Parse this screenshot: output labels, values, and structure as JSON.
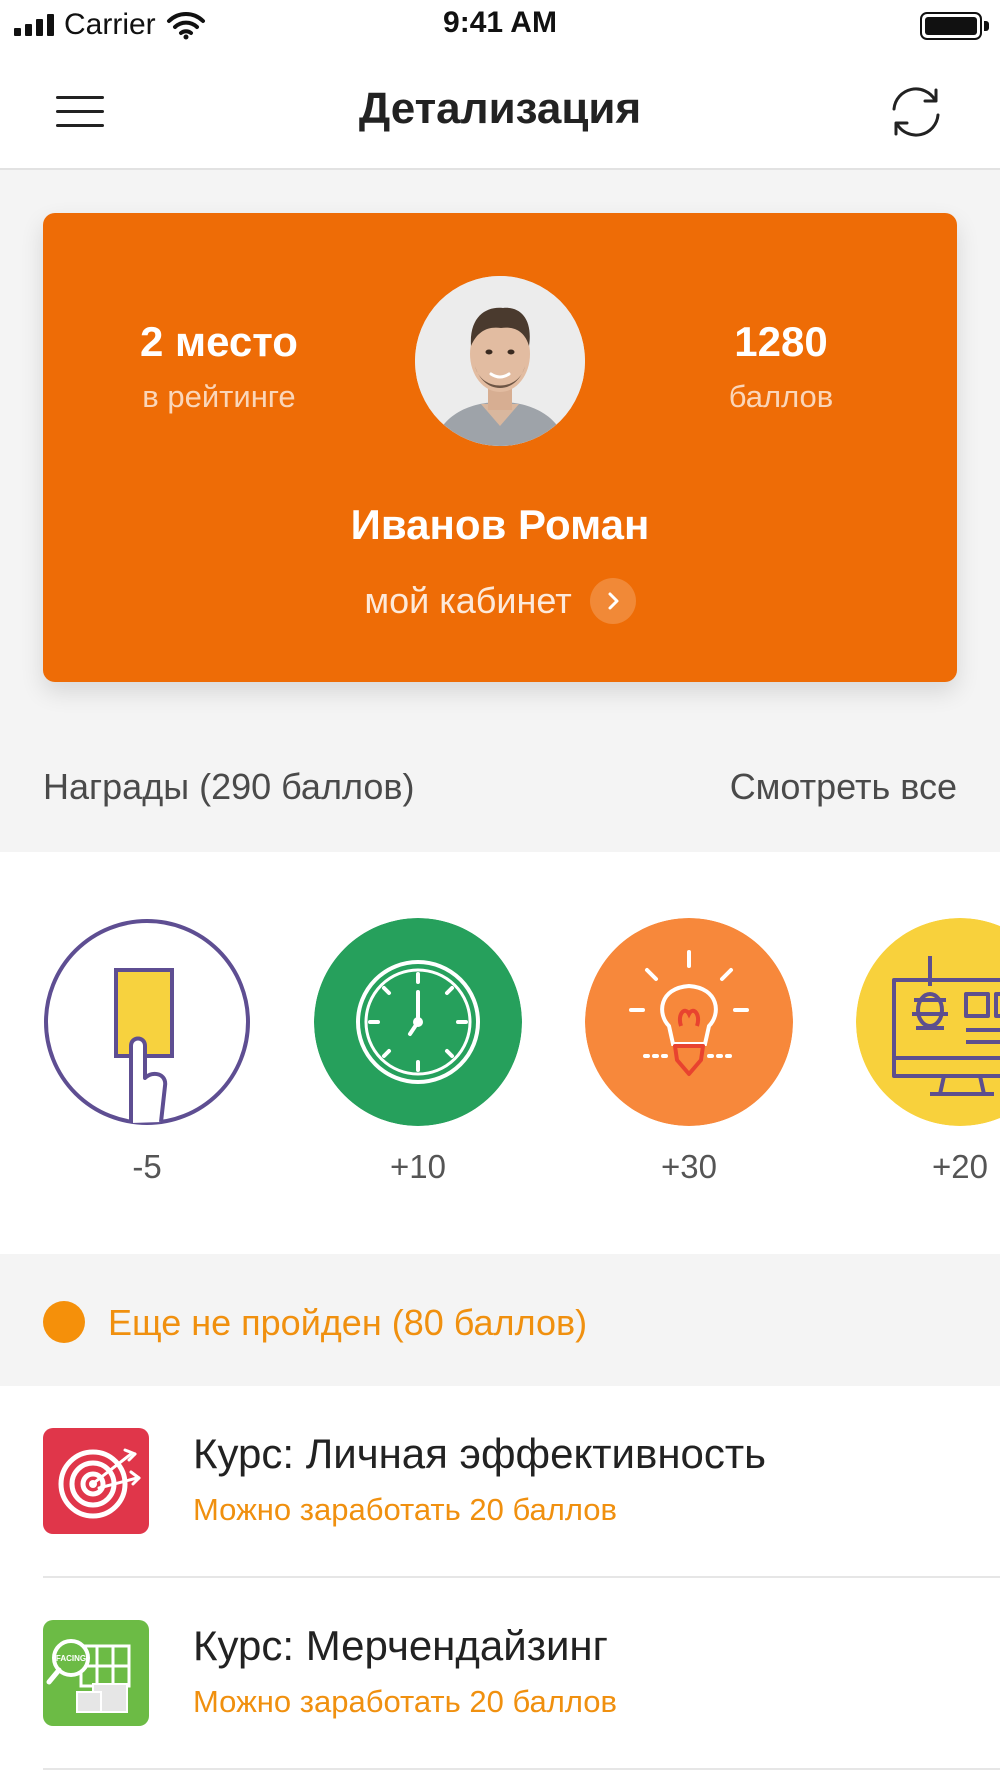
{
  "status_bar": {
    "carrier": "Carrier",
    "time": "9:41 AM"
  },
  "header": {
    "title": "Детализация",
    "menu_icon": "hamburger-icon",
    "refresh_icon": "refresh-icon"
  },
  "profile": {
    "rank_value": "2 место",
    "rank_caption": "в рейтинге",
    "points_value": "1280",
    "points_caption": "баллов",
    "name": "Иванов Роман",
    "cabinet_label": "мой кабинет",
    "card_color": "#ee6c06"
  },
  "rewards": {
    "title": "Награды (290 баллов)",
    "see_all": "Смотреть все",
    "badges": [
      {
        "icon": "yellow-card-icon",
        "points": "-5"
      },
      {
        "icon": "clock-icon",
        "points": "+10"
      },
      {
        "icon": "lightbulb-icon",
        "points": "+30"
      },
      {
        "icon": "bug-on-monitor-icon",
        "points": "+20"
      }
    ]
  },
  "pending": {
    "title": "Еще не пройден (80 баллов)",
    "accent": "#f0900f"
  },
  "courses": [
    {
      "icon": "target-icon",
      "title": "Курс: Личная эффективность",
      "subtitle": "Можно заработать 20 баллов"
    },
    {
      "icon": "merchandising-icon",
      "title": "Курс: Мерчендайзинг",
      "subtitle": "Можно заработать 20 баллов",
      "icon_label": "FACING"
    }
  ]
}
